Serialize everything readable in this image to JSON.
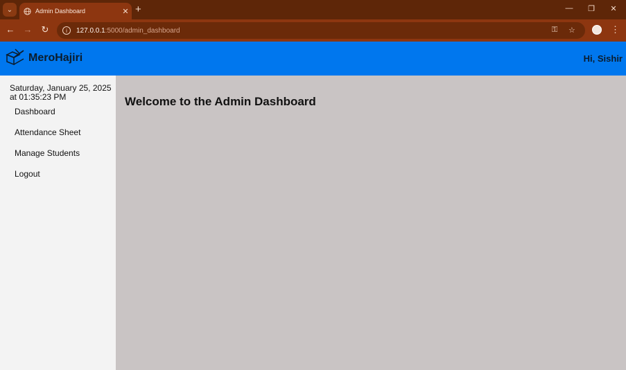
{
  "browser": {
    "tab_title": "Admin Dashboard",
    "url_host": "127.0.0.1",
    "url_rest": ":5000/admin_dashboard"
  },
  "app": {
    "brand": "MeroHajiri",
    "greeting": "Hi, Sishir",
    "accent_color": "#0077ee"
  },
  "sidebar": {
    "datetime_line1": "Saturday, January 25, 2025",
    "datetime_line2": "at 01:35:23 PM",
    "items": [
      {
        "label": "Dashboard"
      },
      {
        "label": "Attendance Sheet"
      },
      {
        "label": "Manage Students"
      },
      {
        "label": "Logout"
      }
    ]
  },
  "main": {
    "title": "Welcome to the Admin Dashboard"
  }
}
